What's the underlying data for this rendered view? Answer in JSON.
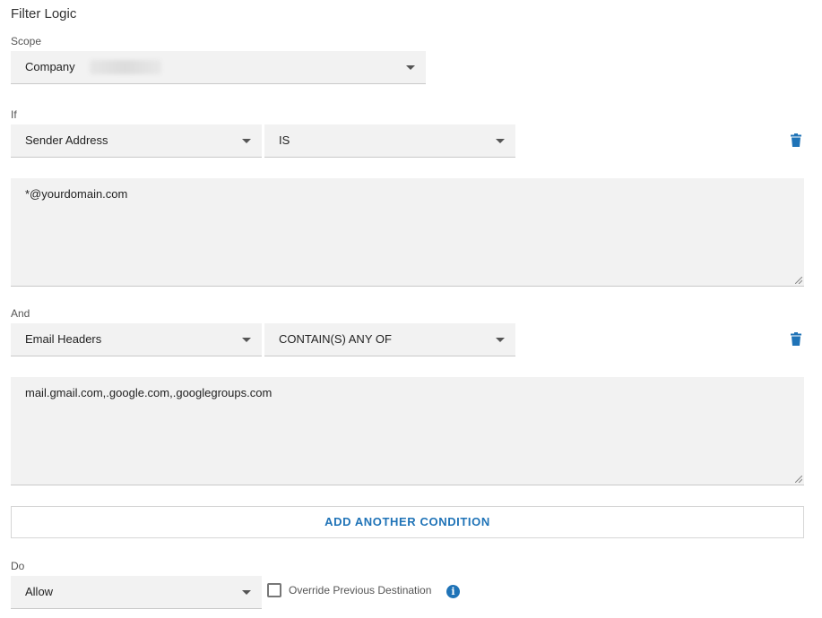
{
  "title": "Filter Logic",
  "scope": {
    "label": "Scope",
    "value": "Company"
  },
  "condition1": {
    "label": "If",
    "field": "Sender Address",
    "operator": "IS",
    "value": "*@yourdomain.com"
  },
  "condition2": {
    "label": "And",
    "field": "Email Headers",
    "operator": "CONTAIN(S) ANY OF",
    "value": "mail.gmail.com,.google.com,.googlegroups.com"
  },
  "add_condition_label": "ADD ANOTHER CONDITION",
  "action": {
    "label": "Do",
    "value": "Allow",
    "override_label": "Override Previous Destination",
    "override_checked": false
  },
  "colors": {
    "accent": "#1f73b7",
    "field_bg": "#f2f2f2"
  },
  "icons": {
    "delete": "trash-icon",
    "info": "info-icon",
    "dropdown": "caret-down-icon"
  }
}
